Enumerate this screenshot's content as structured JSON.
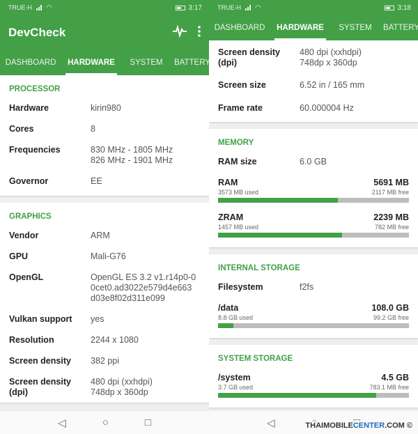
{
  "colors": {
    "accent": "#43a047"
  },
  "left": {
    "status": {
      "carrier": "TRUE-H",
      "time": "3:17"
    },
    "app_title": "DevCheck",
    "icons": {
      "pulse": "pulse-icon",
      "menu": "more-vert-icon"
    },
    "tabs": [
      "DASHBOARD",
      "HARDWARE",
      "SYSTEM",
      "BATTERY"
    ],
    "processor": {
      "header": "PROCESSOR",
      "rows": [
        {
          "k": "Hardware",
          "v1": "kirin980"
        },
        {
          "k": "Cores",
          "v1": "8"
        },
        {
          "k": "Frequencies",
          "v1": "830 MHz - 1805 MHz",
          "v2": "826 MHz - 1901 MHz"
        },
        {
          "k": "Governor",
          "v1": "EE"
        }
      ]
    },
    "graphics": {
      "header": "GRAPHICS",
      "rows": [
        {
          "k": "Vendor",
          "v1": "ARM"
        },
        {
          "k": "GPU",
          "v1": "Mali-G76"
        },
        {
          "k": "OpenGL",
          "v1": "OpenGL ES 3.2 v1.r14p0-0",
          "v2": "0cet0.ad3022e579d4e663",
          "v3": "d03e8f02d311e099"
        },
        {
          "k": "Vulkan support",
          "v1": "yes"
        },
        {
          "k": "Resolution",
          "v1": "2244 x 1080"
        },
        {
          "k": "Screen density",
          "v1": "382 ppi"
        },
        {
          "k": "Screen density",
          "k2": "(dpi)",
          "v1": "480 dpi (xxhdpi)",
          "v2": "748dp x 360dp"
        }
      ]
    }
  },
  "right": {
    "status": {
      "carrier": "TRUE-H",
      "time": "3:18"
    },
    "tabs": [
      "DASHBOARD",
      "HARDWARE",
      "SYSTEM",
      "BATTERY"
    ],
    "display_rows": [
      {
        "k": "Screen density",
        "k2": "(dpi)",
        "v1": "480 dpi (xxhdpi)",
        "v2": "748dp x 360dp"
      },
      {
        "k": "Screen size",
        "v1": "6.52 in / 165 mm"
      },
      {
        "k": "Frame rate",
        "v1": "60.000004 Hz"
      }
    ],
    "memory": {
      "header": "MEMORY",
      "ram_size_label": "RAM size",
      "ram_size_value": "6.0 GB",
      "bars": [
        {
          "name": "RAM",
          "total": "5691 MB",
          "used": "3573 MB used",
          "free": "2117 MB free",
          "fraction": 0.628
        },
        {
          "name": "ZRAM",
          "total": "2239 MB",
          "used": "1457 MB used",
          "free": "782 MB free",
          "fraction": 0.651
        }
      ]
    },
    "internal": {
      "header": "INTERNAL STORAGE",
      "fs_label": "Filesystem",
      "fs_value": "f2fs",
      "bar": {
        "name": "/data",
        "total": "108.0 GB",
        "used": "8.8 GB used",
        "free": "99.2 GB free",
        "fraction": 0.081
      }
    },
    "system": {
      "header": "SYSTEM STORAGE",
      "bar": {
        "name": "/system",
        "total": "4.5 GB",
        "used": "3.7 GB used",
        "free": "783.1 MB free",
        "fraction": 0.83
      }
    },
    "watermark": {
      "a": "THAIMOBILE",
      "b": "CENTER",
      "c": ".COM"
    }
  }
}
